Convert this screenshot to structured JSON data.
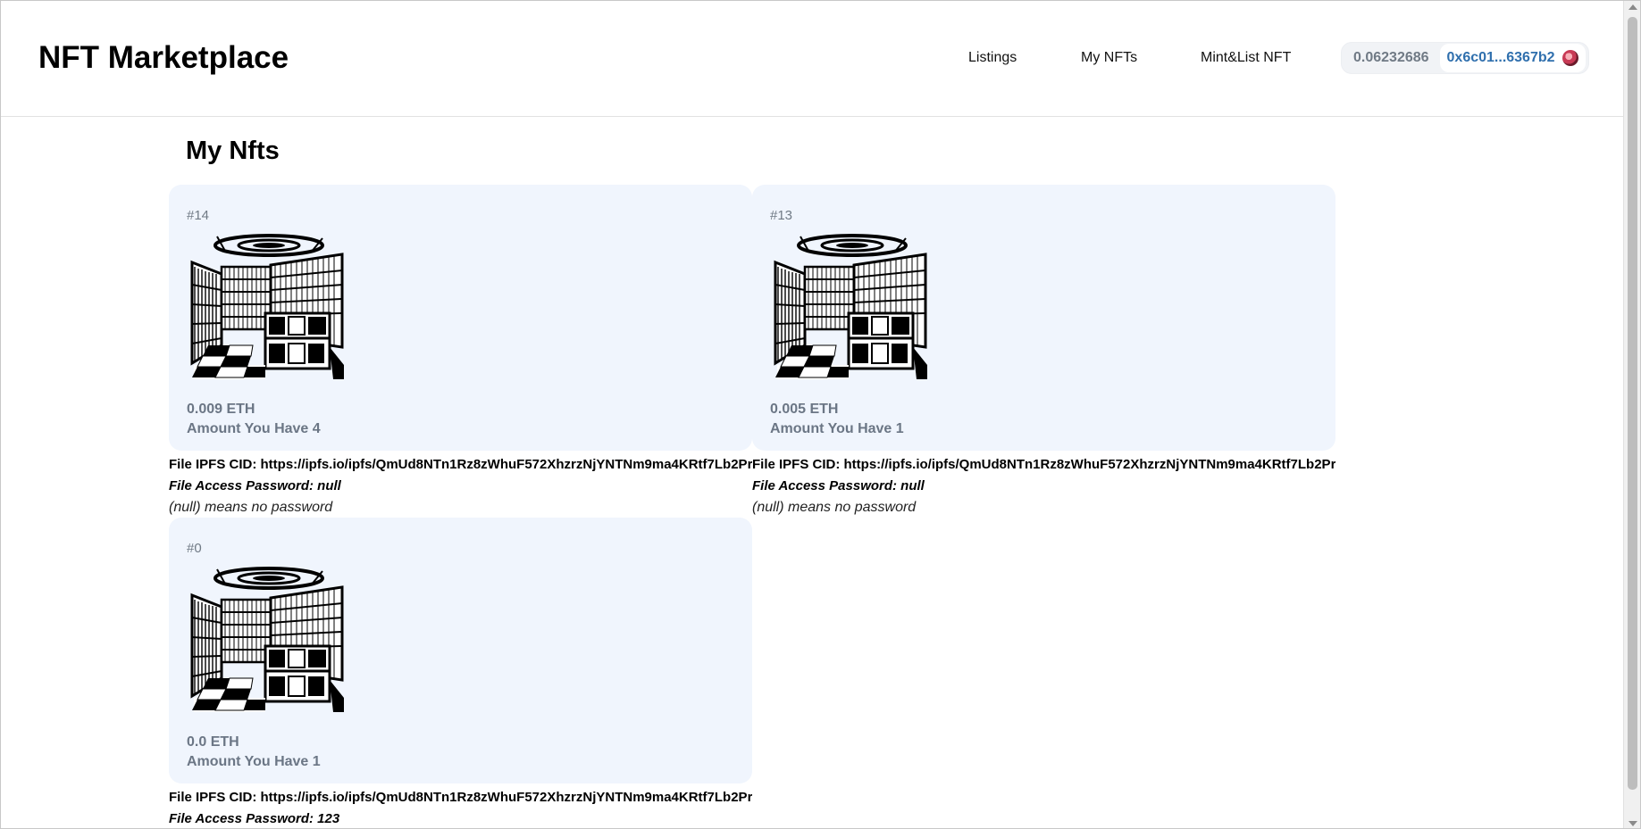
{
  "header": {
    "brand": "NFT Marketplace",
    "nav": {
      "listings": "Listings",
      "my_nfts": "My NFTs",
      "mint_list": "Mint&List NFT"
    },
    "wallet": {
      "balance": "0.06232686",
      "address": "0x6c01...6367b2",
      "avatar_icon": "account-avatar-icon"
    }
  },
  "main": {
    "title": "My Nfts",
    "nfts": [
      {
        "id": "#14",
        "price": "0.009 ETH",
        "amount": "Amount You Have 4",
        "cid": "File IPFS CID: https://ipfs.io/ipfs/QmUd8NTn1Rz8zWhuF572XhzrzNjYNTNm9ma4KRtf7Lb2Pr",
        "password": "File Access Password: null",
        "note": "(null) means no password"
      },
      {
        "id": "#13",
        "price": "0.005 ETH",
        "amount": "Amount You Have 1",
        "cid": "File IPFS CID: https://ipfs.io/ipfs/QmUd8NTn1Rz8zWhuF572XhzrzNjYNTNm9ma4KRtf7Lb2Pr",
        "password": "File Access Password: null",
        "note": "(null) means no password"
      },
      {
        "id": "#0",
        "price": "0.0 ETH",
        "amount": "Amount You Have 1",
        "cid": "File IPFS CID: https://ipfs.io/ipfs/QmUd8NTn1Rz8zWhuF572XhzrzNjYNTNm9ma4KRtf7Lb2Pr",
        "password": "File Access Password: 123",
        "note": ""
      }
    ]
  },
  "colors": {
    "card_bg": "#f0f5fd",
    "muted_text": "#6b7685",
    "address_blue": "#2f6fad"
  }
}
